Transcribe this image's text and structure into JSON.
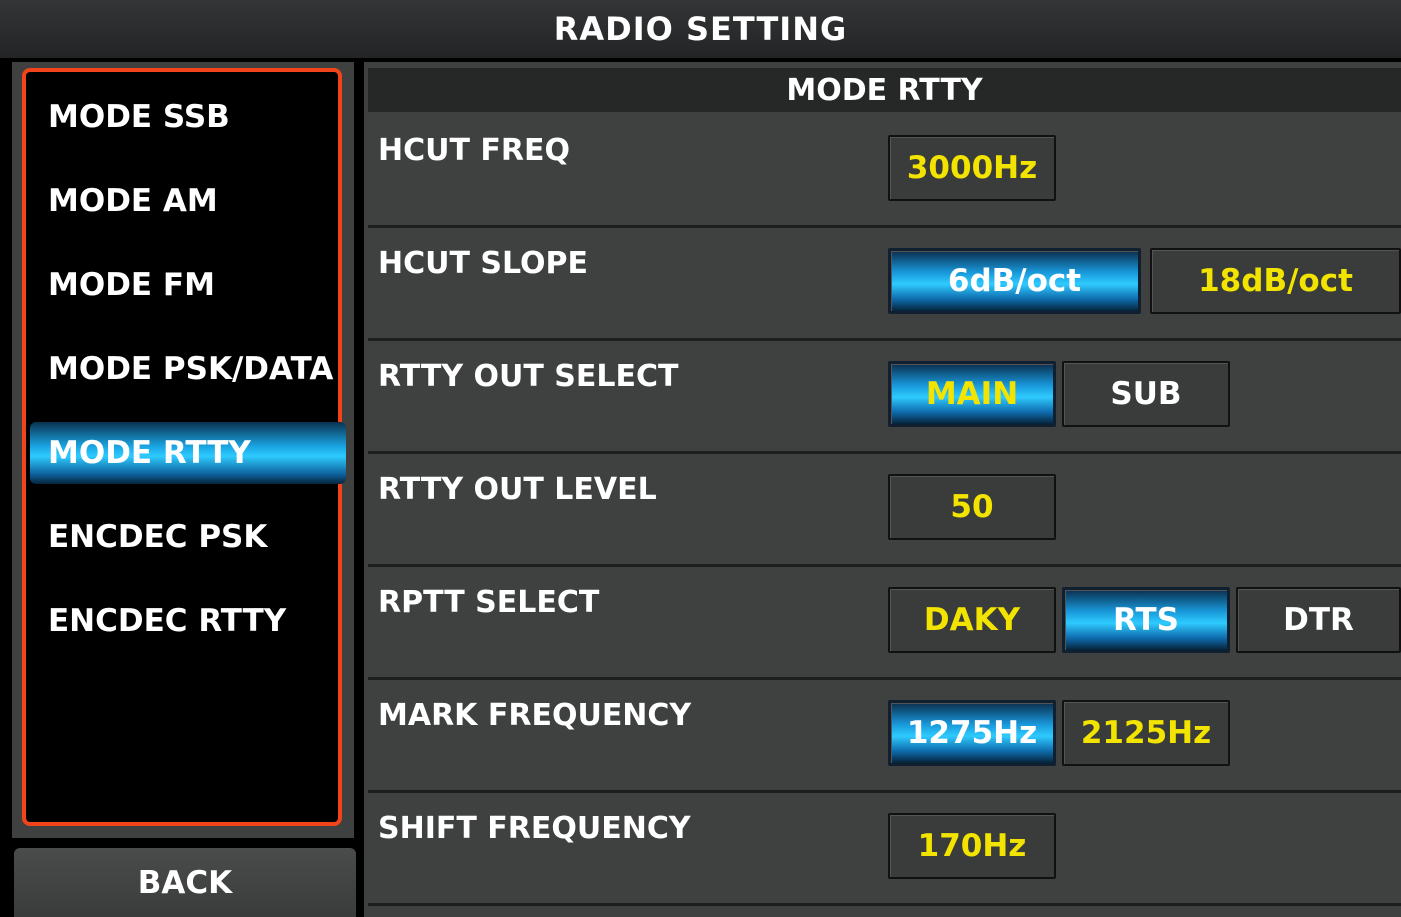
{
  "header": {
    "title": "RADIO SETTING"
  },
  "sidebar": {
    "items": [
      {
        "label": "MODE SSB"
      },
      {
        "label": "MODE AM"
      },
      {
        "label": "MODE FM"
      },
      {
        "label": "MODE PSK/DATA"
      },
      {
        "label": "MODE RTTY",
        "selected": true
      },
      {
        "label": "ENCDEC PSK"
      },
      {
        "label": "ENCDEC RTTY"
      }
    ],
    "back_label": "BACK"
  },
  "main": {
    "section_title": "MODE RTTY",
    "settings": [
      {
        "label": "HCUT FREQ",
        "options": [
          {
            "text": "3000Hz"
          }
        ]
      },
      {
        "label": "HCUT SLOPE",
        "options": [
          {
            "text": "6dB/oct",
            "active": true
          },
          {
            "text": "18dB/oct"
          }
        ]
      },
      {
        "label": "RTTY OUT SELECT",
        "options": [
          {
            "text": "MAIN",
            "active": true
          },
          {
            "text": "SUB"
          }
        ]
      },
      {
        "label": "RTTY OUT LEVEL",
        "options": [
          {
            "text": "50"
          }
        ]
      },
      {
        "label": "RPTT SELECT",
        "options": [
          {
            "text": "DAKY"
          },
          {
            "text": "RTS",
            "active": true
          },
          {
            "text": "DTR"
          }
        ]
      },
      {
        "label": "MARK FREQUENCY",
        "options": [
          {
            "text": "1275Hz",
            "active": true
          },
          {
            "text": "2125Hz"
          }
        ]
      },
      {
        "label": "SHIFT FREQUENCY",
        "options": [
          {
            "text": "170Hz"
          }
        ]
      }
    ]
  },
  "colors": {
    "accent_blue": "#2ecbff",
    "value_yellow": "#f3e400",
    "menu_border": "#f2441a",
    "panel_gray": "#3f4141"
  }
}
